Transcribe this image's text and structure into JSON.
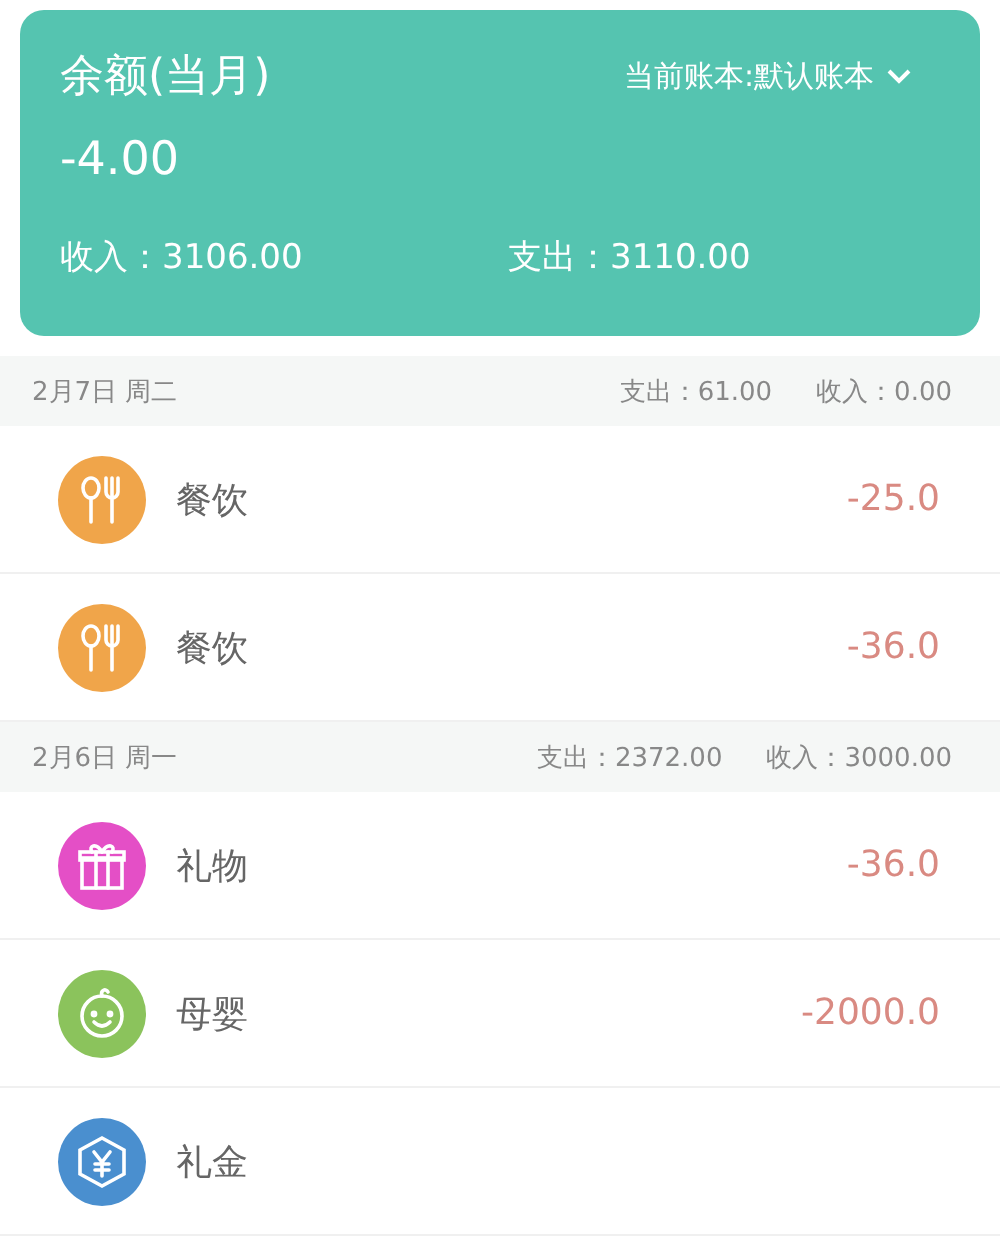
{
  "summary": {
    "title": "余额(当月)",
    "book_selector": "当前账本:默认账本",
    "balance": "-4.00",
    "income": "收入：3106.00",
    "expense": "支出：3110.00"
  },
  "days": [
    {
      "date": "2月7日 周二",
      "expense": "支出：61.00",
      "income": "收入：0.00",
      "entries": [
        {
          "kind": "dining",
          "color": "#f0a54a",
          "label": "餐饮",
          "amount": "-25.0"
        },
        {
          "kind": "dining",
          "color": "#f0a54a",
          "label": "餐饮",
          "amount": "-36.0"
        }
      ]
    },
    {
      "date": "2月6日 周一",
      "expense": "支出：2372.00",
      "income": "收入：3000.00",
      "entries": [
        {
          "kind": "gift",
          "color": "#e44fc6",
          "label": "礼物",
          "amount": "-36.0"
        },
        {
          "kind": "baby",
          "color": "#8bc35c",
          "label": "母婴",
          "amount": "-2000.0"
        },
        {
          "kind": "money",
          "color": "#4a8fcf",
          "label": "礼金"
        }
      ]
    }
  ]
}
